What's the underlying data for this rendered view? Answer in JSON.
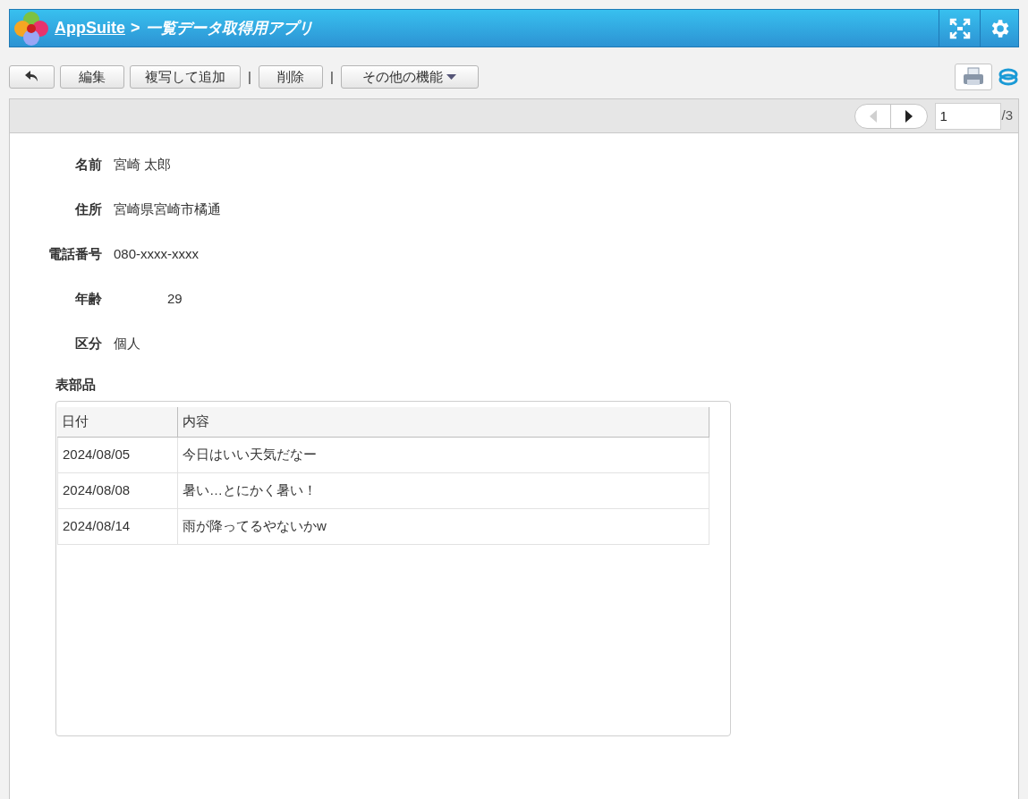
{
  "header": {
    "app": "AppSuite",
    "separator": ">",
    "title": "一覧データ取得用アプリ"
  },
  "toolbar": {
    "buttons": [
      {
        "kind": "back"
      },
      {
        "kind": "text",
        "label": "編集"
      },
      {
        "kind": "text",
        "label": "複写して追加"
      },
      {
        "kind": "sep",
        "label": "|"
      },
      {
        "kind": "text",
        "label": "削除"
      },
      {
        "kind": "sep",
        "label": "|"
      },
      {
        "kind": "menu",
        "label": "その他の機能"
      }
    ]
  },
  "pager": {
    "prev_disabled": true,
    "next_disabled": false,
    "page": "1",
    "total": "/3"
  },
  "fields": [
    {
      "label": "名前",
      "value": "宮崎 太郎",
      "kind": "text"
    },
    {
      "label": "住所",
      "value": "宮崎県宮崎市橘通",
      "kind": "text"
    },
    {
      "label": "電話番号",
      "value": "080-xxxx-xxxx",
      "kind": "text"
    },
    {
      "label": "年齢",
      "value": "29",
      "kind": "number"
    },
    {
      "label": "区分",
      "value": "個人",
      "kind": "text"
    }
  ],
  "table": {
    "title": "表部品",
    "columns": [
      "日付",
      "内容"
    ],
    "rows": [
      [
        "2024/08/05",
        "今日はいい天気だなー"
      ],
      [
        "2024/08/08",
        "暑い…とにかく暑い！"
      ],
      [
        "2024/08/14",
        "雨が降ってるやないかw"
      ]
    ]
  }
}
